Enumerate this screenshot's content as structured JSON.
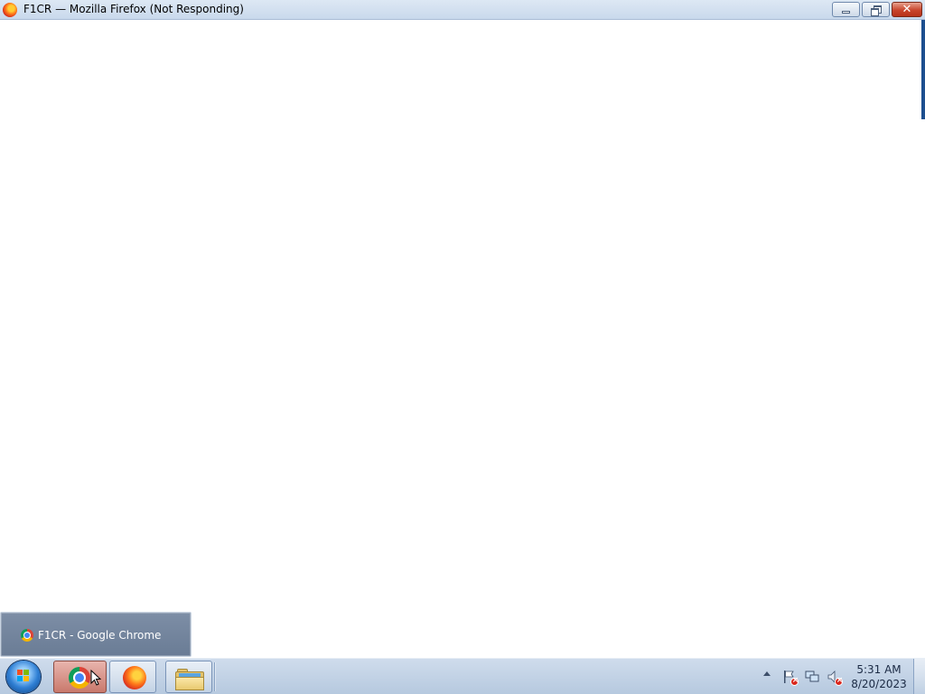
{
  "window": {
    "title": "F1CR — Mozilla Firefox (Not Responding)",
    "app_icon": "firefox-icon",
    "controls": {
      "minimize_icon": "minimize-icon",
      "maximize_icon": "restore-icon",
      "close_icon": "close-icon"
    }
  },
  "taskbar_preview": {
    "icon": "chrome-icon",
    "label": "F1CR - Google Chrome"
  },
  "taskbar": {
    "start_icon": "windows-start-icon",
    "pinned": [
      {
        "name": "Google Chrome",
        "icon": "chrome-icon",
        "active": true
      },
      {
        "name": "Mozilla Firefox",
        "icon": "firefox-icon",
        "active": false
      },
      {
        "name": "Windows Explorer",
        "icon": "folder-icon",
        "active": false
      }
    ],
    "tray": {
      "icons": [
        "show-hidden-icons-icon",
        "action-center-flag-icon",
        "network-icon",
        "volume-muted-icon"
      ],
      "time": "5:31 AM",
      "date": "8/20/2023"
    }
  }
}
